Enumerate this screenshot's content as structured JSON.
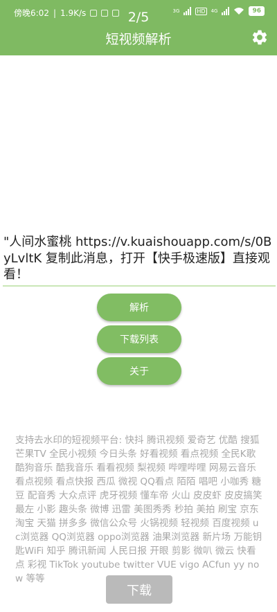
{
  "status_bar": {
    "time": "傍晚6:02",
    "speed": "1.9K/s",
    "network_a": "3G",
    "hd": "HD",
    "network_b": "4G",
    "battery": "96",
    "icons": [
      "notification-icon",
      "shield-icon",
      "app-icon",
      "signal-icon",
      "wifi-icon",
      "battery-icon"
    ]
  },
  "header": {
    "pager": "2/5",
    "title": "短视频解析",
    "settings_icon": "gear-icon",
    "background": "#7fba62"
  },
  "input": {
    "value": "\"人间水蜜桃 https://v.kuaishouapp.com/s/0ByLvltK 复制此消息，打开【快手极速版】直接观看！"
  },
  "buttons": {
    "parse": "解析",
    "download_list": "下载列表",
    "about": "关于"
  },
  "platforms_text": "支持去水印的短视频平台: 快抖 腾讯视频 爱奇艺 优酷 搜狐 芒果TV 全民小视频 今日头条 好看视频 看点视频 全民K歌 酷狗音乐 酷我音乐 看看视频 梨视频 哔哩哔哩 网易云音乐 看点视频 看点快报 西瓜 微视 QQ看点 陌陌 唱吧 小咖秀 糖豆 配音秀 大众点评 虎牙视频 懂车帝 火山 皮皮虾 皮皮搞笑 最左 小影 趣头条 微博 迅雷 美图秀秀 秒拍 美拍 刷宝 京东 淘宝 天猫 拼多多 微信公众号 火锅视频 轻视频 百度视频 uc浏览器 QQ浏览器 oppo浏览器 油果浏览器 新片场 万能钥匙WiFi 知乎 腾讯新闻 人民日报 开眼 剪影 微叭 微云 快看点 彩视 TikTok youtube twitter VUE vigo ACfun yy now 等等",
  "download_button": "下载",
  "colors": {
    "accent": "#7fba62",
    "button": "#81bd63",
    "underline": "#c9e7b6",
    "muted_text": "#a8a8a8"
  }
}
